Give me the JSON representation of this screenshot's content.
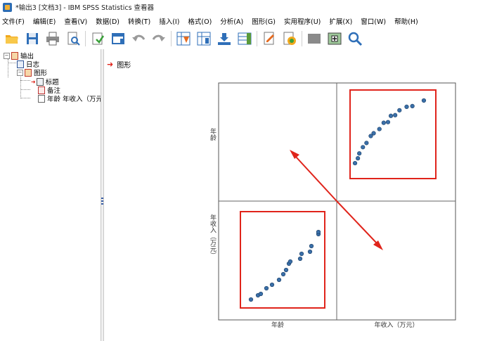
{
  "window": {
    "title": "*输出3 [文档3] - IBM SPSS Statistics 查看器"
  },
  "menu": [
    "文件(F)",
    "编辑(E)",
    "查看(V)",
    "数据(D)",
    "转换(T)",
    "插入(I)",
    "格式(O)",
    "分析(A)",
    "图形(G)",
    "实用程序(U)",
    "扩展(X)",
    "窗口(W)",
    "帮助(H)"
  ],
  "toolbar": [
    "open-icon",
    "save-icon",
    "print-icon",
    "print-preview-icon",
    "export-icon",
    "recall-dialog-icon",
    "undo-icon",
    "redo-icon",
    "goto-case-icon",
    "goto-variable-icon",
    "variables-icon",
    "data-view-icon",
    "designate-window-icon",
    "insert-output-icon",
    "hide-icon",
    "promote-icon",
    "search-icon"
  ],
  "tree": {
    "root": "输出",
    "log": "日志",
    "graph": "图形",
    "title": "标题",
    "note": "备注",
    "chart": "年龄 年收入（万元"
  },
  "content": {
    "heading": "图形"
  },
  "chart_data": {
    "type": "scatter",
    "layout": "scatter-matrix",
    "variables": [
      "年龄",
      "年收入（万元）"
    ],
    "axis_labels": {
      "row_top": "年龄",
      "row_bottom": "年收入（万元）",
      "col_left": "年龄",
      "col_right": "年收入（万元）"
    },
    "points_top_right": [
      {
        "x": 0.02,
        "y": 0.08
      },
      {
        "x": 0.06,
        "y": 0.15
      },
      {
        "x": 0.08,
        "y": 0.22
      },
      {
        "x": 0.13,
        "y": 0.31
      },
      {
        "x": 0.18,
        "y": 0.37
      },
      {
        "x": 0.24,
        "y": 0.47
      },
      {
        "x": 0.28,
        "y": 0.51
      },
      {
        "x": 0.36,
        "y": 0.57
      },
      {
        "x": 0.42,
        "y": 0.66
      },
      {
        "x": 0.48,
        "y": 0.67
      },
      {
        "x": 0.52,
        "y": 0.76
      },
      {
        "x": 0.58,
        "y": 0.77
      },
      {
        "x": 0.64,
        "y": 0.84
      },
      {
        "x": 0.74,
        "y": 0.89
      },
      {
        "x": 0.82,
        "y": 0.9
      },
      {
        "x": 0.98,
        "y": 0.98
      }
    ],
    "points_bottom_left": [
      {
        "x": 0.02,
        "y": 0.02
      },
      {
        "x": 0.12,
        "y": 0.08
      },
      {
        "x": 0.16,
        "y": 0.1
      },
      {
        "x": 0.24,
        "y": 0.18
      },
      {
        "x": 0.32,
        "y": 0.23
      },
      {
        "x": 0.42,
        "y": 0.3
      },
      {
        "x": 0.48,
        "y": 0.38
      },
      {
        "x": 0.52,
        "y": 0.44
      },
      {
        "x": 0.56,
        "y": 0.53
      },
      {
        "x": 0.58,
        "y": 0.56
      },
      {
        "x": 0.72,
        "y": 0.6
      },
      {
        "x": 0.74,
        "y": 0.67
      },
      {
        "x": 0.86,
        "y": 0.7
      },
      {
        "x": 0.88,
        "y": 0.78
      },
      {
        "x": 0.98,
        "y": 0.95
      },
      {
        "x": 0.98,
        "y": 0.98
      }
    ],
    "point_color": "#3a6fa8",
    "annotation_color": "#e0241b"
  }
}
